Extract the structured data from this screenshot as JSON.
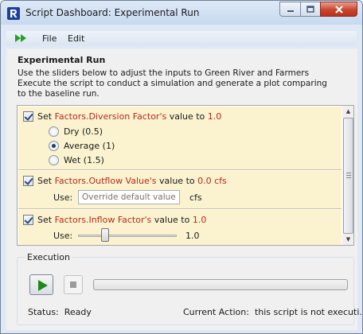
{
  "window": {
    "title": "Script Dashboard: Experimental Run",
    "icons": {
      "app": "riverware-app-icon",
      "minimize": "minimize-icon",
      "maximize": "maximize-icon",
      "close": "close-icon"
    }
  },
  "menu": {
    "run_icon": "run-fast-forward-icon",
    "items": [
      {
        "label": "File"
      },
      {
        "label": "Edit"
      }
    ]
  },
  "main": {
    "heading": "Experimental Run",
    "description_lines": [
      "Use the sliders below to adjust the inputs to Green River and Farmers",
      "Execute the script to conduct a simulation and generate a plot comparing",
      "to the baseline run."
    ]
  },
  "sections": [
    {
      "checked": true,
      "prefix": "Set ",
      "slot": "Factors.Diversion Factor's",
      "middle": " value to ",
      "value": "1.0",
      "options": [
        {
          "label": "Dry (0.5)",
          "selected": false
        },
        {
          "label": "Average (1)",
          "selected": true
        },
        {
          "label": "Wet (1.5)",
          "selected": false
        }
      ]
    },
    {
      "checked": true,
      "prefix": "Set ",
      "slot": "Factors.Outflow Value's",
      "middle": " value to ",
      "value": "0.0 cfs",
      "use_label": "Use:",
      "input_placeholder": "Override default value",
      "unit": "cfs"
    },
    {
      "checked": true,
      "prefix": "Set ",
      "slot": "Factors.Inflow Factor's",
      "middle": " value to ",
      "value": "1.0",
      "use_label": "Use:",
      "slider_value": "1.0",
      "slider_fraction": 0.25
    }
  ],
  "execution": {
    "group_label": "Execution",
    "status_label": "Status:",
    "status_value": "Ready",
    "action_label": "Current Action:",
    "action_value": "this script is not executi...",
    "progress": 0
  },
  "colors": {
    "accent_red": "#b5291c",
    "section_bg": "#fbf3cf",
    "play_green": "#1b8a1b"
  }
}
